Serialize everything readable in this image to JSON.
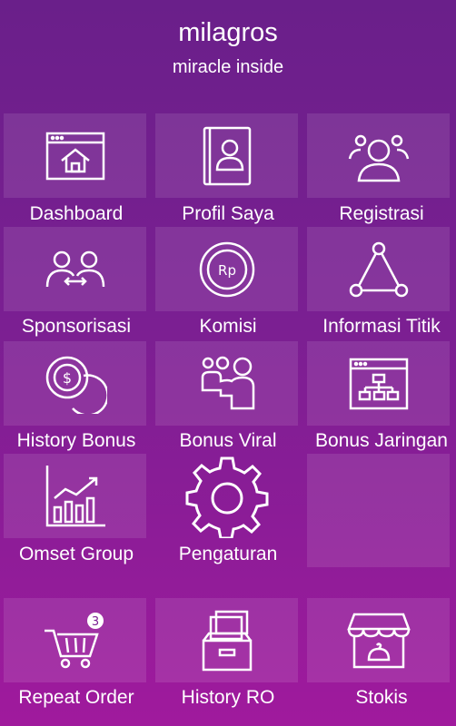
{
  "header": {
    "title": "milagros",
    "subtitle": "miracle inside"
  },
  "menu": [
    {
      "label": "Dashboard",
      "icon": "dashboard-icon"
    },
    {
      "label": "Profil Saya",
      "icon": "profile-icon"
    },
    {
      "label": "Registrasi",
      "icon": "registration-icon"
    },
    {
      "label": "Sponsorisasi",
      "icon": "sponsor-icon"
    },
    {
      "label": "Komisi",
      "icon": "commission-rp-icon"
    },
    {
      "label": "Informasi Titik",
      "icon": "network-point-icon"
    },
    {
      "label": "History Bonus",
      "icon": "coins-icon"
    },
    {
      "label": "Bonus Viral",
      "icon": "group-people-icon"
    },
    {
      "label": "Bonus Jaringan",
      "icon": "network-chart-icon"
    },
    {
      "label": "Omset Group",
      "icon": "bar-chart-icon"
    },
    {
      "label": "Pengaturan",
      "icon": "gear-icon"
    }
  ],
  "bottom_menu": [
    {
      "label": "Repeat Order",
      "icon": "cart-icon",
      "badge": "3"
    },
    {
      "label": "History RO",
      "icon": "boxes-icon"
    },
    {
      "label": "Stokis",
      "icon": "store-icon"
    }
  ]
}
